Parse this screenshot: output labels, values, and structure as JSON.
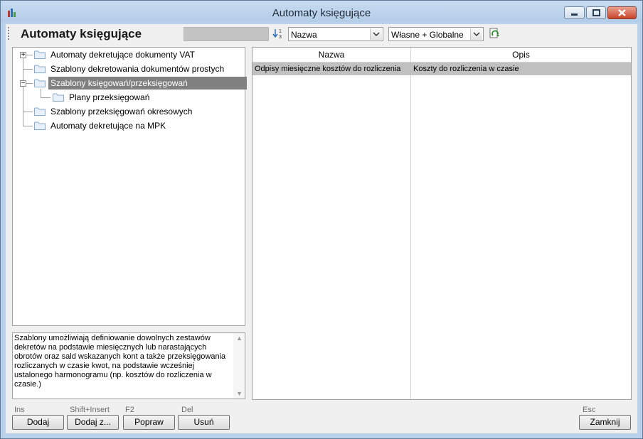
{
  "window": {
    "title": "Automaty księgujące"
  },
  "toolbar": {
    "page_title": "Automaty księgujące",
    "sort_combo_value": "Nazwa",
    "scope_combo_value": "Własne + Globalne"
  },
  "tree": {
    "items": [
      {
        "label": "Automaty dekretujące dokumenty VAT",
        "expander": "+"
      },
      {
        "label": "Szablony dekretowania dokumentów prostych"
      },
      {
        "label": "Szablony księgowań/przeksięgowań",
        "expander": "−",
        "selected": true
      },
      {
        "label": "Plany przeksięgowań"
      },
      {
        "label": "Szablony przeksięgowań okresowych"
      },
      {
        "label": "Automaty dekretujące na MPK"
      }
    ]
  },
  "description": {
    "text": "Szablony umożliwiają definiowanie dowolnych zestawów dekretów na podstawie miesięcznych lub narastających obrotów oraz sald wskazanych kont a także przeksięgowania rozliczanych w czasie kwot, na podstawie wcześniej ustalonego harmonogramu (np. kosztów do rozliczenia w czasie.)"
  },
  "grid": {
    "columns": [
      "Nazwa",
      "Opis"
    ],
    "rows": [
      {
        "nazwa": "Odpisy miesięczne kosztów do rozliczenia",
        "opis": "Koszty do rozliczenia w czasie"
      }
    ]
  },
  "buttons": {
    "add": {
      "shortcut": "Ins",
      "label": "Dodaj"
    },
    "add_copy": {
      "shortcut": "Shift+Insert",
      "label": "Dodaj z..."
    },
    "edit": {
      "shortcut": "F2",
      "label": "Popraw"
    },
    "delete": {
      "shortcut": "Del",
      "label": "Usuń"
    },
    "close": {
      "shortcut": "Esc",
      "label": "Zamknij"
    }
  }
}
